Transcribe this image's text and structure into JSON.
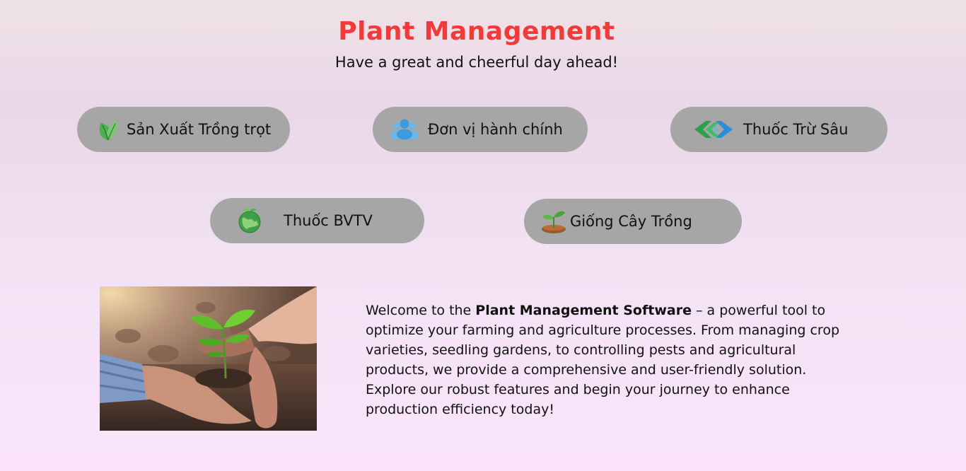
{
  "header": {
    "title": "Plant Management",
    "subtitle": "Have a great and cheerful day ahead!"
  },
  "menu": [
    {
      "label": "Sản Xuất Trồng trọt",
      "icon": "leaf-icon"
    },
    {
      "label": "Đơn vị hành chính",
      "icon": "people-icon"
    },
    {
      "label": "Thuốc  Trừ Sâu",
      "icon": "arrows-logo-icon"
    },
    {
      "label": "Thuốc BVTV",
      "icon": "globe-leaf-icon"
    },
    {
      "label": "Giống Cây Trồng",
      "icon": "sprout-icon"
    }
  ],
  "intro": {
    "prefix": "Welcome to the ",
    "bold": "Plant Management Software",
    "suffix": " – a powerful tool to optimize your farming and agriculture processes. From managing crop varieties, seedling gardens, to controlling pests and agricultural products, we provide a comprehensive and user-friendly solution. Explore our robust features and begin your journey to enhance production efficiency today!"
  },
  "colors": {
    "title": "#f33a3a",
    "button_bg": "#a6a6a6"
  }
}
